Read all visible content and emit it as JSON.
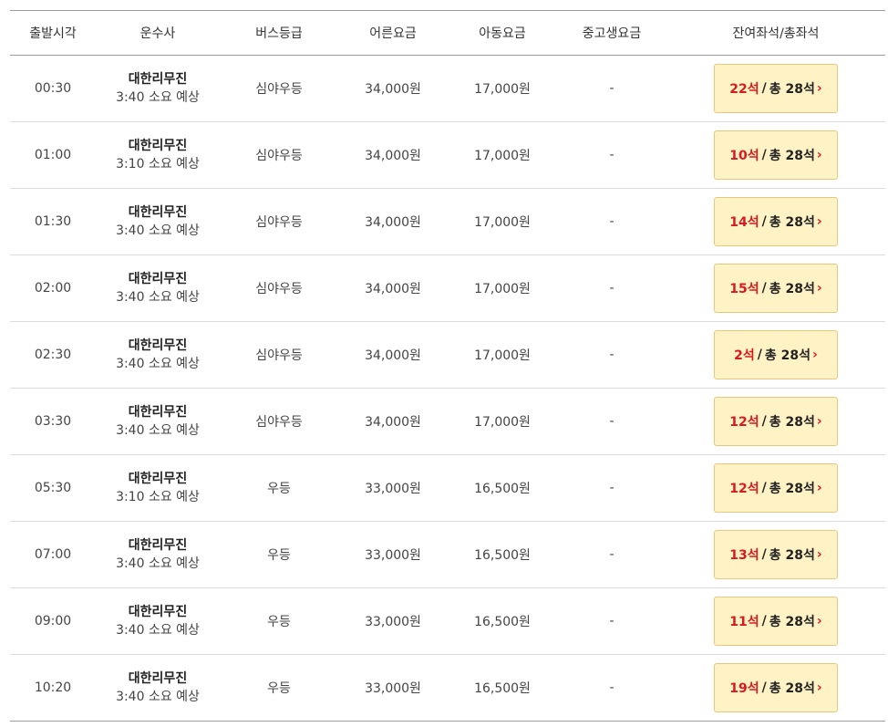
{
  "headers": {
    "time": "출발시각",
    "corp": "운수사",
    "grade": "버스등급",
    "adult": "어른요금",
    "child": "아동요금",
    "teen": "중고생요금",
    "seats": "잔여좌석/총좌석"
  },
  "seat_labels": {
    "separator": "/",
    "arrow": "›"
  },
  "rows": [
    {
      "time": "00:30",
      "corp": "대한리무진",
      "duration": "3:40 소요 예상",
      "grade": "심야우등",
      "adult": "34,000원",
      "child": "17,000원",
      "teen": "-",
      "remain": "22석",
      "total": "총 28석"
    },
    {
      "time": "01:00",
      "corp": "대한리무진",
      "duration": "3:10 소요 예상",
      "grade": "심야우등",
      "adult": "34,000원",
      "child": "17,000원",
      "teen": "-",
      "remain": "10석",
      "total": "총 28석"
    },
    {
      "time": "01:30",
      "corp": "대한리무진",
      "duration": "3:40 소요 예상",
      "grade": "심야우등",
      "adult": "34,000원",
      "child": "17,000원",
      "teen": "-",
      "remain": "14석",
      "total": "총 28석"
    },
    {
      "time": "02:00",
      "corp": "대한리무진",
      "duration": "3:40 소요 예상",
      "grade": "심야우등",
      "adult": "34,000원",
      "child": "17,000원",
      "teen": "-",
      "remain": "15석",
      "total": "총 28석"
    },
    {
      "time": "02:30",
      "corp": "대한리무진",
      "duration": "3:40 소요 예상",
      "grade": "심야우등",
      "adult": "34,000원",
      "child": "17,000원",
      "teen": "-",
      "remain": "2석",
      "total": "총 28석"
    },
    {
      "time": "03:30",
      "corp": "대한리무진",
      "duration": "3:40 소요 예상",
      "grade": "심야우등",
      "adult": "34,000원",
      "child": "17,000원",
      "teen": "-",
      "remain": "12석",
      "total": "총 28석"
    },
    {
      "time": "05:30",
      "corp": "대한리무진",
      "duration": "3:10 소요 예상",
      "grade": "우등",
      "adult": "33,000원",
      "child": "16,500원",
      "teen": "-",
      "remain": "12석",
      "total": "총 28석"
    },
    {
      "time": "07:00",
      "corp": "대한리무진",
      "duration": "3:40 소요 예상",
      "grade": "우등",
      "adult": "33,000원",
      "child": "16,500원",
      "teen": "-",
      "remain": "13석",
      "total": "총 28석"
    },
    {
      "time": "09:00",
      "corp": "대한리무진",
      "duration": "3:40 소요 예상",
      "grade": "우등",
      "adult": "33,000원",
      "child": "16,500원",
      "teen": "-",
      "remain": "11석",
      "total": "총 28석"
    },
    {
      "time": "10:20",
      "corp": "대한리무진",
      "duration": "3:40 소요 예상",
      "grade": "우등",
      "adult": "33,000원",
      "child": "16,500원",
      "teen": "-",
      "remain": "19석",
      "total": "총 28석"
    }
  ],
  "colors": {
    "remain_seat": "#d71920",
    "seat_button_bg": "#fff2c4",
    "seat_button_border": "#e6c77e"
  }
}
